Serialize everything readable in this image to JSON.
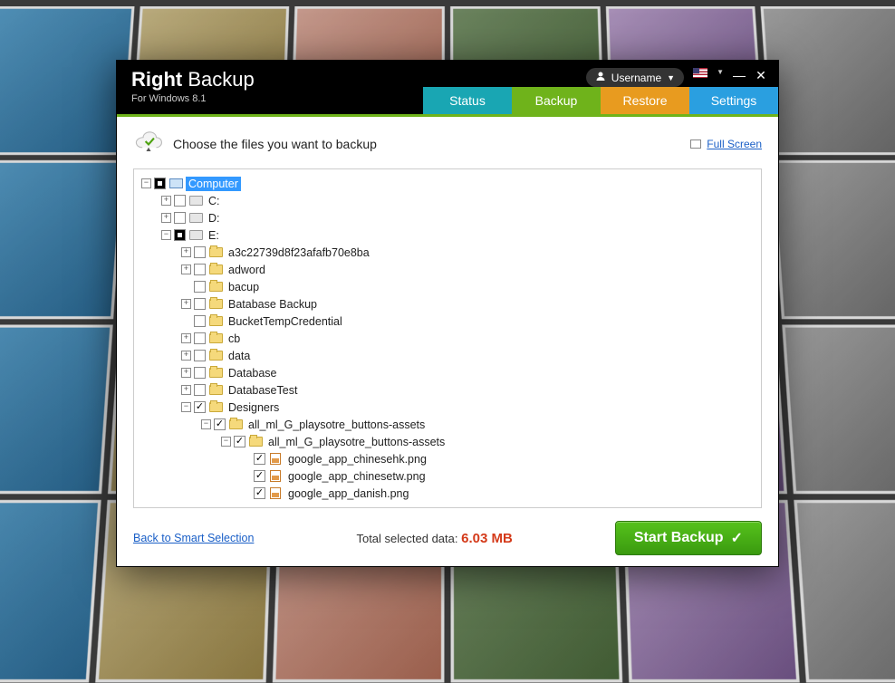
{
  "brand": {
    "bold": "Right",
    "light": " Backup",
    "sub": "For Windows 8.1"
  },
  "user": {
    "label": "Username"
  },
  "tabs": {
    "status": "Status",
    "backup": "Backup",
    "restore": "Restore",
    "settings": "Settings"
  },
  "header": {
    "text": "Choose the files you want to backup",
    "fullscreen": "Full Screen"
  },
  "tree": [
    {
      "depth": 0,
      "expand": "-",
      "check": "mixed",
      "icon": "computer",
      "label": "Computer",
      "selected": true
    },
    {
      "depth": 1,
      "expand": "+",
      "check": "none",
      "icon": "drive",
      "label": "C:"
    },
    {
      "depth": 1,
      "expand": "+",
      "check": "none",
      "icon": "drive",
      "label": "D:"
    },
    {
      "depth": 1,
      "expand": "-",
      "check": "mixed",
      "icon": "drive",
      "label": "E:"
    },
    {
      "depth": 2,
      "expand": "+",
      "check": "none",
      "icon": "folder",
      "label": "a3c22739d8f23afafb70e8ba"
    },
    {
      "depth": 2,
      "expand": "+",
      "check": "none",
      "icon": "folder",
      "label": "adword"
    },
    {
      "depth": 2,
      "expand": "",
      "check": "none",
      "icon": "folder",
      "label": "bacup"
    },
    {
      "depth": 2,
      "expand": "+",
      "check": "none",
      "icon": "folder",
      "label": "Batabase Backup"
    },
    {
      "depth": 2,
      "expand": "",
      "check": "none",
      "icon": "folder",
      "label": "BucketTempCredential"
    },
    {
      "depth": 2,
      "expand": "+",
      "check": "none",
      "icon": "folder",
      "label": "cb"
    },
    {
      "depth": 2,
      "expand": "+",
      "check": "none",
      "icon": "folder",
      "label": "data"
    },
    {
      "depth": 2,
      "expand": "+",
      "check": "none",
      "icon": "folder",
      "label": "Database"
    },
    {
      "depth": 2,
      "expand": "+",
      "check": "none",
      "icon": "folder",
      "label": "DatabaseTest"
    },
    {
      "depth": 2,
      "expand": "-",
      "check": "checked",
      "icon": "folder",
      "label": "Designers"
    },
    {
      "depth": 3,
      "expand": "-",
      "check": "checked",
      "icon": "folder",
      "label": "all_ml_G_playsotre_buttons-assets"
    },
    {
      "depth": 4,
      "expand": "-",
      "check": "checked",
      "icon": "folder",
      "label": "all_ml_G_playsotre_buttons-assets"
    },
    {
      "depth": 5,
      "expand": "",
      "check": "checked",
      "icon": "png",
      "label": "google_app_chinesehk.png"
    },
    {
      "depth": 5,
      "expand": "",
      "check": "checked",
      "icon": "png",
      "label": "google_app_chinesetw.png"
    },
    {
      "depth": 5,
      "expand": "",
      "check": "checked",
      "icon": "png",
      "label": "google_app_danish.png"
    }
  ],
  "footer": {
    "back": "Back to Smart Selection",
    "total_label": "Total selected data: ",
    "total_value": "6.03 MB",
    "start": "Start Backup"
  }
}
